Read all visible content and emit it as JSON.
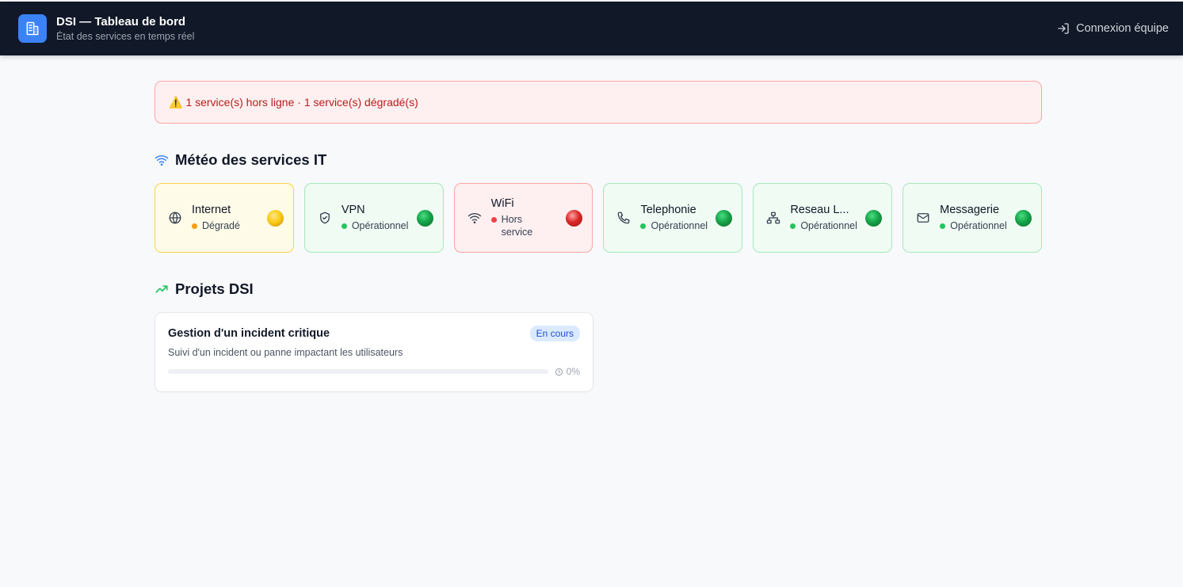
{
  "header": {
    "title": "DSI — Tableau de bord",
    "subtitle": "État des services en temps réel",
    "login_label": "Connexion équipe",
    "logo_icon": "building-icon",
    "login_icon": "login-icon"
  },
  "alert": {
    "icon": "⚠️",
    "text": "1 service(s) hors ligne · 1 service(s) dégradé(s)"
  },
  "services_section": {
    "title": "Météo des services IT",
    "icon": "wifi-icon",
    "items": [
      {
        "name": "Internet",
        "status": "Dégradé",
        "state": "degraded",
        "icon": "globe-icon"
      },
      {
        "name": "VPN",
        "status": "Opérationnel",
        "state": "ok",
        "icon": "shield-icon"
      },
      {
        "name": "WiFi",
        "status": "Hors service",
        "state": "down",
        "icon": "wifi-icon"
      },
      {
        "name": "Telephonie",
        "status": "Opérationnel",
        "state": "ok",
        "icon": "phone-icon"
      },
      {
        "name": "Reseau L...",
        "status": "Opérationnel",
        "state": "ok",
        "icon": "network-icon"
      },
      {
        "name": "Messagerie",
        "status": "Opérationnel",
        "state": "ok",
        "icon": "mail-icon"
      }
    ]
  },
  "projects_section": {
    "title": "Projets DSI",
    "icon": "trending-up-icon",
    "items": [
      {
        "title": "Gestion d'un incident critique",
        "badge": "En cours",
        "description": "Suivi d'un incident ou panne impactant les utilisateurs",
        "progress_label": "0%",
        "progress": 0
      }
    ]
  },
  "colors": {
    "header_bg": "#111827",
    "accent": "#3b82f6",
    "degraded": "#f59e0b",
    "ok": "#22c55e",
    "down": "#ef4444"
  }
}
